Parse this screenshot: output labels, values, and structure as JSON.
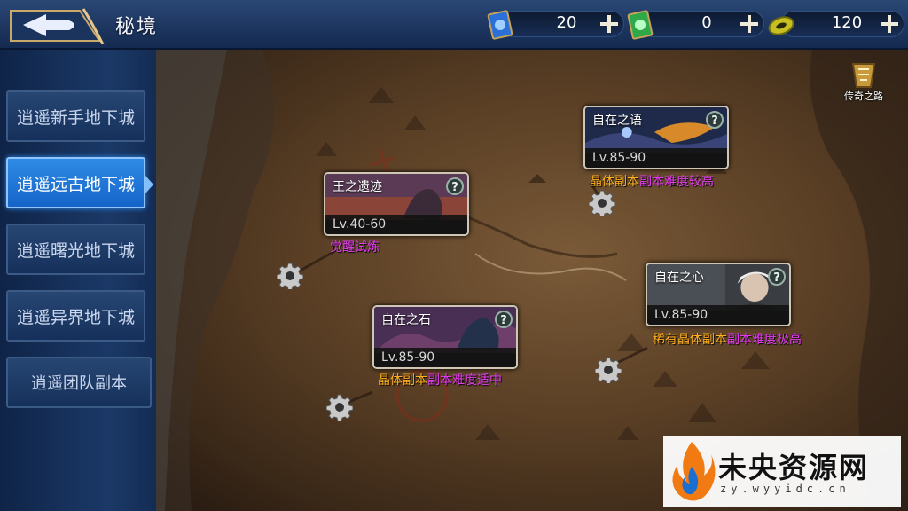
{
  "header": {
    "title": "秘境",
    "back_icon": "back-arrow-icon"
  },
  "currencies": [
    {
      "name": "blue-ticket",
      "value": "20",
      "icon": "blue-ticket-icon",
      "color": "#2b6fd8"
    },
    {
      "name": "green-ticket",
      "value": "0",
      "icon": "green-ticket-icon",
      "color": "#2fa84a"
    },
    {
      "name": "gold-coin",
      "value": "120",
      "icon": "gold-coin-icon",
      "color": "#c8c020"
    }
  ],
  "sidebar": {
    "items": [
      {
        "label": "逍遥新手地下城",
        "active": false
      },
      {
        "label": "逍遥远古地下城",
        "active": true
      },
      {
        "label": "逍遥曙光地下城",
        "active": false
      },
      {
        "label": "逍遥异界地下城",
        "active": false
      },
      {
        "label": "逍遥团队副本",
        "active": false
      }
    ]
  },
  "map": {
    "legend_label": "传奇之路",
    "dungeons": [
      {
        "name": "王之遗迹",
        "level": "Lv.40-60",
        "tag_parts": [
          {
            "text": "觉醒试炼",
            "color": "purple"
          }
        ]
      },
      {
        "name": "自在之语",
        "level": "Lv.85-90",
        "tag_parts": [
          {
            "text": "晶体副本",
            "color": "orange"
          },
          {
            "text": "副本难度较高",
            "color": "purple"
          }
        ]
      },
      {
        "name": "自在之石",
        "level": "Lv.85-90",
        "tag_parts": [
          {
            "text": "晶体副本",
            "color": "orange"
          },
          {
            "text": "副本难度适中",
            "color": "purple"
          }
        ]
      },
      {
        "name": "自在之心",
        "level": "Lv.85-90",
        "tag_parts": [
          {
            "text": "稀有晶体副本",
            "color": "orange"
          },
          {
            "text": "副本难度极高",
            "color": "purple"
          }
        ]
      }
    ],
    "help_symbol": "?"
  },
  "watermark": {
    "brand": "未央资源网",
    "url": "zy.wyyidc.cn"
  },
  "colors": {
    "accent_blue": "#1f74d8",
    "tag_orange": "#ffb020",
    "tag_purple": "#e23cf0"
  }
}
